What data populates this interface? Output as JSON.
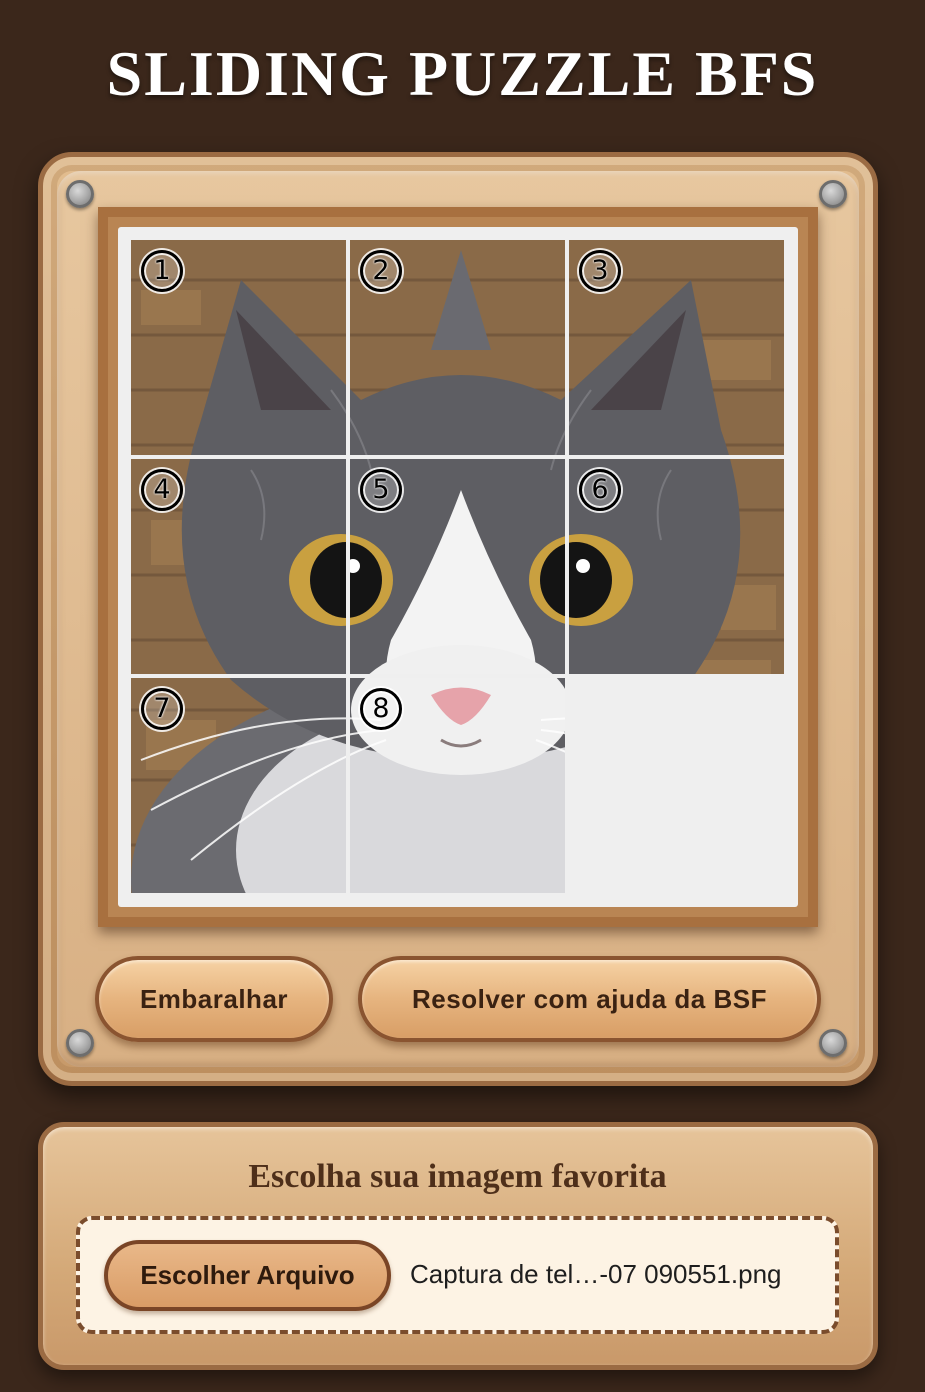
{
  "header": {
    "title": "SLIDING PUZZLE BFS"
  },
  "puzzle": {
    "grid_size": 3,
    "tiles": [
      {
        "number": "1",
        "row": 0,
        "col": 0
      },
      {
        "number": "2",
        "row": 0,
        "col": 1
      },
      {
        "number": "3",
        "row": 0,
        "col": 2
      },
      {
        "number": "4",
        "row": 1,
        "col": 0
      },
      {
        "number": "5",
        "row": 1,
        "col": 1
      },
      {
        "number": "6",
        "row": 1,
        "col": 2
      },
      {
        "number": "7",
        "row": 2,
        "col": 0
      },
      {
        "number": "8",
        "row": 2,
        "col": 1
      }
    ],
    "empty_cell": {
      "row": 2,
      "col": 2
    },
    "image": "cat-photo"
  },
  "controls": {
    "shuffle_label": "Embaralhar",
    "solve_label": "Resolver com ajuda da BSF"
  },
  "upload": {
    "title": "Escolha sua imagem favorita",
    "choose_file_label": "Escolher Arquivo",
    "file_name": "Captura de tel…-07 090551.png"
  },
  "colors": {
    "background": "#3b271b",
    "board_wood": "#d3a979",
    "board_border": "#9b6b43",
    "button_text": "#3a2212",
    "empty_cell": "#efefef"
  }
}
